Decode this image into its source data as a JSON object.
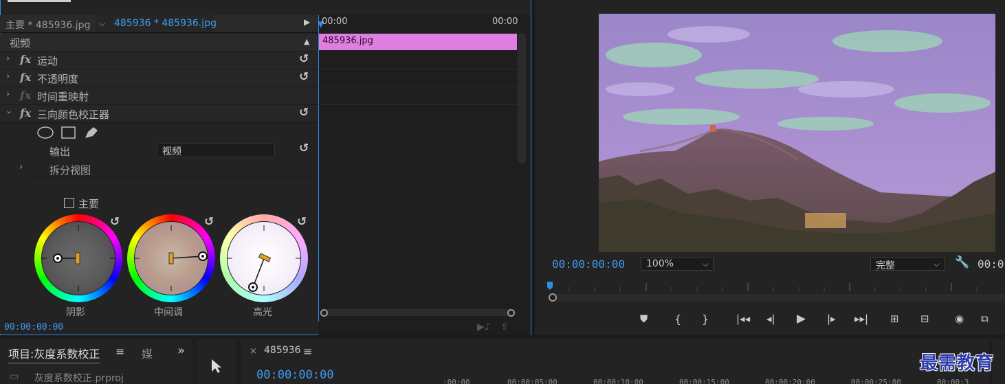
{
  "effect_controls": {
    "source_tab": "主要 * 485936.jpg",
    "sequence_tab": "485936 * 485936.jpg",
    "time_start": "00:00",
    "time_end": "00:00",
    "section_video": "视频",
    "effects": [
      {
        "label": "运动"
      },
      {
        "label": "不透明度"
      },
      {
        "label": "时间重映射"
      },
      {
        "label": "三向颜色校正器"
      }
    ],
    "output_label": "输出",
    "output_value": "视频",
    "split_view_label": "拆分视图",
    "master_label": "主要",
    "wheels": [
      {
        "label": "阴影"
      },
      {
        "label": "中间调"
      },
      {
        "label": "高光"
      }
    ],
    "timecode": "00:00:00:00",
    "clip_name": "485936.jpg"
  },
  "program_monitor": {
    "timecode": "00:00:00:00",
    "zoom": "100%",
    "quality": "完整",
    "timecode_right": "00:0"
  },
  "project_panel": {
    "title": "项目:灰度系数校正",
    "menu_icon": "≡",
    "media_tab": "媒",
    "expand": "»",
    "file": "灰度系数校正.prproj"
  },
  "sequence": {
    "close": "×",
    "name": "485936",
    "menu_icon": "≡",
    "timecode": "00:00:00:00",
    "ticks": [
      ":00:00",
      "00:00:05:00",
      "00:00:10:00",
      "00:00:15:00",
      "00:00:20:00",
      "00:00:25:00",
      "00:00:3"
    ]
  },
  "watermark": "最需教育"
}
